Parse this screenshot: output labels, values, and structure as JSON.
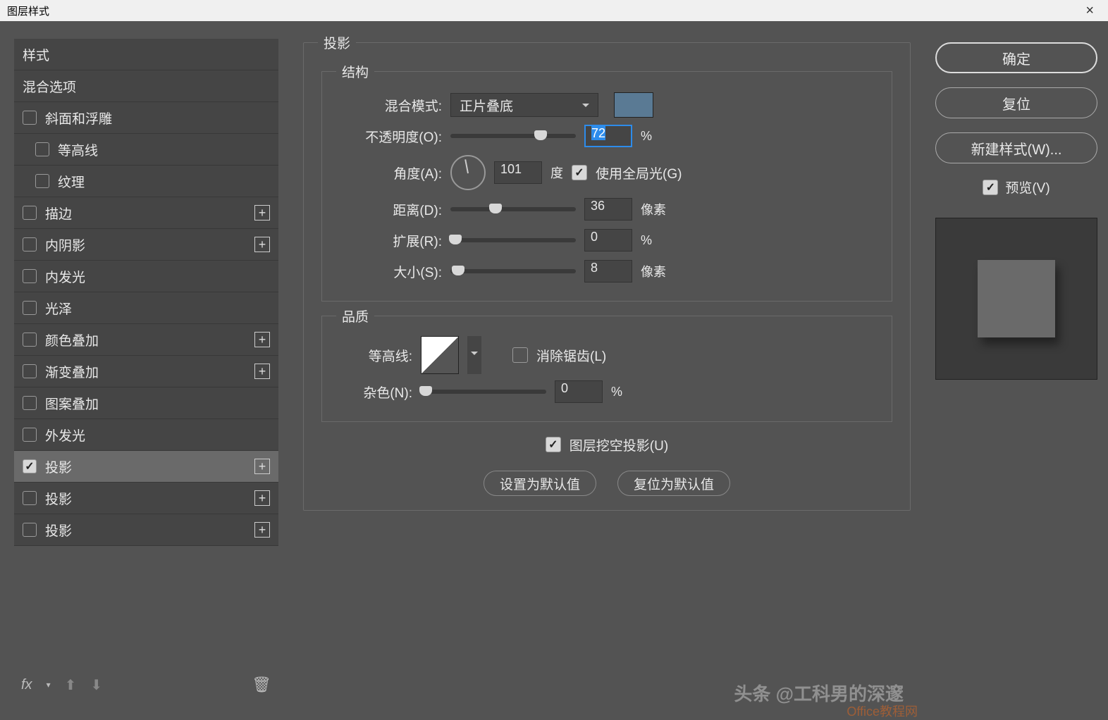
{
  "title": "图层样式",
  "sidebar": {
    "items": [
      {
        "label": "样式",
        "type": "header"
      },
      {
        "label": "混合选项",
        "type": "header"
      },
      {
        "label": "斜面和浮雕",
        "type": "check"
      },
      {
        "label": "等高线",
        "type": "subcheck"
      },
      {
        "label": "纹理",
        "type": "subcheck"
      },
      {
        "label": "描边",
        "type": "check",
        "add": true
      },
      {
        "label": "内阴影",
        "type": "check",
        "add": true
      },
      {
        "label": "内发光",
        "type": "check"
      },
      {
        "label": "光泽",
        "type": "check"
      },
      {
        "label": "颜色叠加",
        "type": "check",
        "add": true
      },
      {
        "label": "渐变叠加",
        "type": "check",
        "add": true
      },
      {
        "label": "图案叠加",
        "type": "check"
      },
      {
        "label": "外发光",
        "type": "check"
      },
      {
        "label": "投影",
        "type": "check",
        "checked": true,
        "selected": true,
        "add": true
      },
      {
        "label": "投影",
        "type": "check",
        "add": true
      },
      {
        "label": "投影",
        "type": "check",
        "add": true
      }
    ],
    "fx_label": "fx"
  },
  "panel": {
    "title": "投影",
    "structure": {
      "legend": "结构",
      "blend_mode_label": "混合模式:",
      "blend_mode_value": "正片叠底",
      "color": "#5a7a94",
      "opacity_label": "不透明度(O):",
      "opacity_value": "72",
      "opacity_unit": "%",
      "angle_label": "角度(A):",
      "angle_value": "101",
      "angle_unit": "度",
      "global_light_label": "使用全局光(G)",
      "distance_label": "距离(D):",
      "distance_value": "36",
      "distance_unit": "像素",
      "spread_label": "扩展(R):",
      "spread_value": "0",
      "spread_unit": "%",
      "size_label": "大小(S):",
      "size_value": "8",
      "size_unit": "像素"
    },
    "quality": {
      "legend": "品质",
      "contour_label": "等高线:",
      "antialias_label": "消除锯齿(L)",
      "noise_label": "杂色(N):",
      "noise_value": "0",
      "noise_unit": "%"
    },
    "knockout_label": "图层挖空投影(U)",
    "make_default": "设置为默认值",
    "reset_default": "复位为默认值"
  },
  "right": {
    "ok": "确定",
    "cancel": "复位",
    "new_style": "新建样式(W)...",
    "preview_label": "预览(V)"
  },
  "watermark": "头条 @工科男的深邃",
  "watermark2": "Office教程网"
}
